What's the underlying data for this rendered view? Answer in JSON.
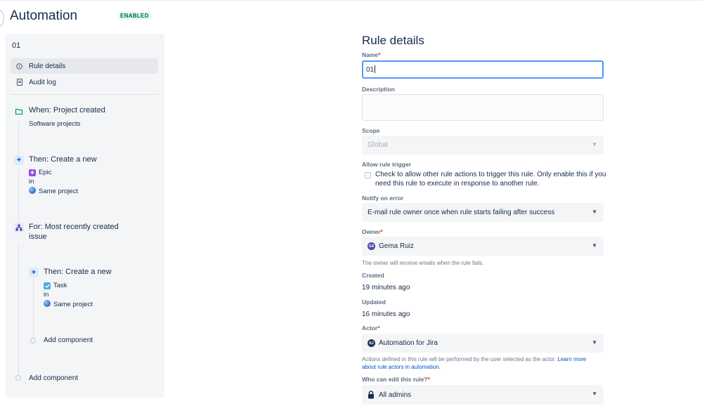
{
  "header": {
    "title": "Automation",
    "status_badge": "ENABLED"
  },
  "sidebar": {
    "rule_name": "01",
    "nav": [
      {
        "label": "Rule details",
        "icon": "info-icon",
        "selected": true
      },
      {
        "label": "Audit log",
        "icon": "document-icon",
        "selected": false
      }
    ],
    "components": {
      "trigger": {
        "title": "When: Project created",
        "subtitle": "Software projects",
        "icon": "folder-icon"
      },
      "action1": {
        "title": "Then: Create a new",
        "issue_type": "Epic",
        "in_label": "in",
        "project": "Same project",
        "icon": "plus-icon"
      },
      "branch": {
        "title_line1": "For: Most recently created",
        "title_line2": "issue",
        "icon": "branch-icon"
      },
      "action2": {
        "title": "Then: Create a new",
        "issue_type": "Task",
        "in_label": "in",
        "project": "Same project",
        "icon": "plus-icon"
      },
      "add_inner": "Add component",
      "add_outer": "Add component"
    }
  },
  "form": {
    "title": "Rule details",
    "name": {
      "label": "Name",
      "value": "01"
    },
    "description": {
      "label": "Description",
      "value": ""
    },
    "scope": {
      "label": "Scope",
      "value": "Global"
    },
    "allow_trigger": {
      "label": "Allow rule trigger",
      "text_line1": "Check to allow other rule actions to trigger this rule. Only enable this if you",
      "text_line2": "need this rule to execute in response to another rule."
    },
    "notify": {
      "label": "Notify on error",
      "value": "E-mail rule owner once when rule starts failing after success"
    },
    "owner": {
      "label": "Owner",
      "value": "Gema Ruiz",
      "initials": "GR",
      "help": "The owner will receive emails when the rule fails."
    },
    "created": {
      "label": "Created",
      "value": "19 minutes ago"
    },
    "updated": {
      "label": "Updated",
      "value": "16 minutes ago"
    },
    "actor": {
      "label": "Actor",
      "value": "Automation for Jira",
      "initials": "AJ",
      "help_line1": "Actions defined in this rule will be performed by the user selected as the actor.",
      "help_link1": "Learn more",
      "help_link2": "about rule actors in automation."
    },
    "who_can_edit": {
      "label": "Who can edit this rule?",
      "value": "All admins"
    }
  },
  "colors": {
    "accent": "#0052cc",
    "enabled_badge_bg": "#e3fcef",
    "enabled_badge_text": "#006644",
    "required": "#de350b"
  }
}
